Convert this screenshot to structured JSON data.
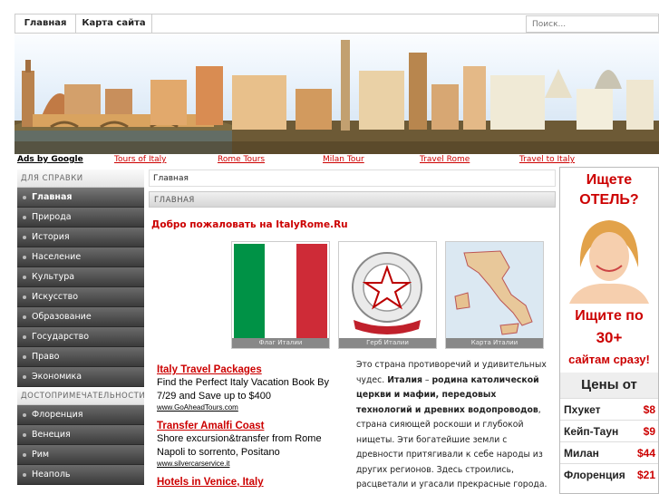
{
  "nav": {
    "home": "Главная",
    "sitemap": "Карта сайта",
    "search_placeholder": "Поиск..."
  },
  "ads_bar": {
    "ads_by": "Ads by Google",
    "links": [
      "Tours of Italy",
      "Rome Tours",
      "Milan Tour",
      "Travel Rome",
      "Travel to Italy"
    ]
  },
  "sidebar": {
    "head1": "ДЛЯ СПРАВКИ",
    "items1": [
      "Главная",
      "Природа",
      "История",
      "Население",
      "Культура",
      "Искусство",
      "Образование",
      "Государство",
      "Право",
      "Экономика"
    ],
    "head2": "ДОСТОПРИМЕЧАТЕЛЬНОСТИ",
    "items2": [
      "Флоренция",
      "Венеция",
      "Рим",
      "Неаполь"
    ]
  },
  "content": {
    "breadcrumb": "Главная",
    "section": "ГЛАВНАЯ",
    "welcome": "Добро пожаловать на ItalyRome.Ru",
    "pictures": [
      "Флаг Италии",
      "Герб Италии",
      "Карта Италии"
    ],
    "ads": [
      {
        "title": "Italy Travel Packages",
        "desc": "Find the Perfect Italy Vacation Book By 7/29 and Save up to $400",
        "url": "www.GoAheadTours.com"
      },
      {
        "title": "Transfer Amalfi Coast",
        "desc": "Shore excursion&transfer from Rome Napoli to sorrento, Positano",
        "url": "www.silvercarservice.it"
      },
      {
        "title": "Hotels in Venice, Italy",
        "desc": "",
        "url": ""
      }
    ],
    "article_lead": "Это страна противоречий и удивительных чудес.",
    "article_strong_1": "Италия",
    "article_dash": " – ",
    "article_strong_2": "родина католической церкви и мафии, передовых технологий и древних водопроводов",
    "article_rest": ", страна сияющей роскоши и глубокой нищеты. Эти богатейшие земли с древности притягивали к себе народы из других регионов. Здесь строились, расцветали и угасали прекрасные города. Вклад, который"
  },
  "right_ad": {
    "q1": "Ищете",
    "q2": "ОТЕЛЬ?",
    "q3": "Ищите по",
    "q4": "30+",
    "q5": "сайтам сразу!",
    "price_head": "Цены от",
    "prices": [
      {
        "city": "Пхукет",
        "value": "$8"
      },
      {
        "city": "Кейп-Таун",
        "value": "$9"
      },
      {
        "city": "Милан",
        "value": "$44"
      },
      {
        "city": "Флоренция",
        "value": "$21"
      }
    ]
  },
  "colors": {
    "accent": "#cc0000",
    "flag_green": "#009246",
    "flag_red": "#ce2b37"
  }
}
